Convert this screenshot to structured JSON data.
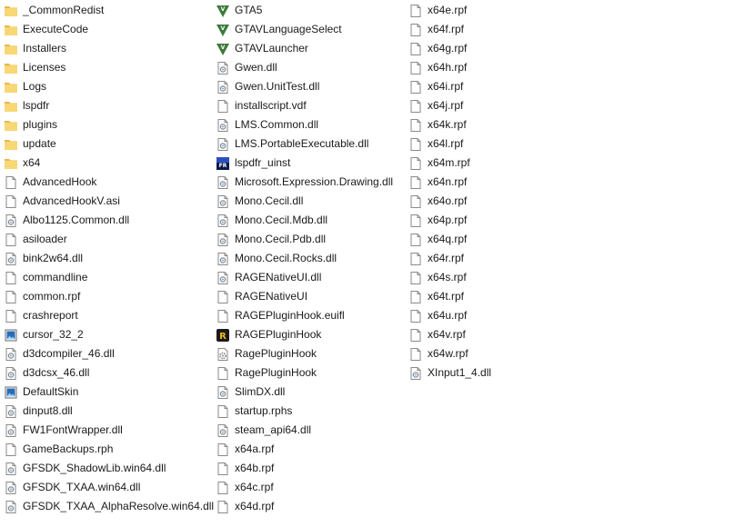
{
  "columns": [
    [
      {
        "label": "_CommonRedist",
        "icon": "folder"
      },
      {
        "label": "ExecuteCode",
        "icon": "folder"
      },
      {
        "label": "Installers",
        "icon": "folder"
      },
      {
        "label": "Licenses",
        "icon": "folder"
      },
      {
        "label": "Logs",
        "icon": "folder"
      },
      {
        "label": "lspdfr",
        "icon": "folder"
      },
      {
        "label": "plugins",
        "icon": "folder"
      },
      {
        "label": "update",
        "icon": "folder"
      },
      {
        "label": "x64",
        "icon": "folder"
      },
      {
        "label": "AdvancedHook",
        "icon": "file"
      },
      {
        "label": "AdvancedHookV.asi",
        "icon": "file"
      },
      {
        "label": "Albo1125.Common.dll",
        "icon": "dll"
      },
      {
        "label": "asiloader",
        "icon": "file"
      },
      {
        "label": "bink2w64.dll",
        "icon": "dll"
      },
      {
        "label": "commandline",
        "icon": "file"
      },
      {
        "label": "common.rpf",
        "icon": "file"
      },
      {
        "label": "crashreport",
        "icon": "file"
      },
      {
        "label": "cursor_32_2",
        "icon": "image"
      },
      {
        "label": "d3dcompiler_46.dll",
        "icon": "dll"
      },
      {
        "label": "d3dcsx_46.dll",
        "icon": "dll"
      },
      {
        "label": "DefaultSkin",
        "icon": "image"
      },
      {
        "label": "dinput8.dll",
        "icon": "dll"
      },
      {
        "label": "FW1FontWrapper.dll",
        "icon": "dll"
      },
      {
        "label": "GameBackups.rph",
        "icon": "file"
      },
      {
        "label": "GFSDK_ShadowLib.win64.dll",
        "icon": "dll"
      },
      {
        "label": "GFSDK_TXAA.win64.dll",
        "icon": "dll"
      },
      {
        "label": "GFSDK_TXAA_AlphaResolve.win64.dll",
        "icon": "dll"
      }
    ],
    [
      {
        "label": "GTA5",
        "icon": "gta"
      },
      {
        "label": "GTAVLanguageSelect",
        "icon": "gta"
      },
      {
        "label": "GTAVLauncher",
        "icon": "gta"
      },
      {
        "label": "Gwen.dll",
        "icon": "dll"
      },
      {
        "label": "Gwen.UnitTest.dll",
        "icon": "dll"
      },
      {
        "label": "installscript.vdf",
        "icon": "file"
      },
      {
        "label": "LMS.Common.dll",
        "icon": "dll"
      },
      {
        "label": "LMS.PortableExecutable.dll",
        "icon": "dll"
      },
      {
        "label": "lspdfr_uinst",
        "icon": "uninst"
      },
      {
        "label": "Microsoft.Expression.Drawing.dll",
        "icon": "dll"
      },
      {
        "label": "Mono.Cecil.dll",
        "icon": "dll"
      },
      {
        "label": "Mono.Cecil.Mdb.dll",
        "icon": "dll"
      },
      {
        "label": "Mono.Cecil.Pdb.dll",
        "icon": "dll"
      },
      {
        "label": "Mono.Cecil.Rocks.dll",
        "icon": "dll"
      },
      {
        "label": "RAGENativeUI.dll",
        "icon": "dll"
      },
      {
        "label": "RAGENativeUI",
        "icon": "file"
      },
      {
        "label": "RAGEPluginHook.euifl",
        "icon": "file"
      },
      {
        "label": "RAGEPluginHook",
        "icon": "rage"
      },
      {
        "label": "RagePluginHook",
        "icon": "config"
      },
      {
        "label": "RagePluginHook",
        "icon": "file"
      },
      {
        "label": "SlimDX.dll",
        "icon": "dll"
      },
      {
        "label": "startup.rphs",
        "icon": "file"
      },
      {
        "label": "steam_api64.dll",
        "icon": "dll"
      },
      {
        "label": "x64a.rpf",
        "icon": "file"
      },
      {
        "label": "x64b.rpf",
        "icon": "file"
      },
      {
        "label": "x64c.rpf",
        "icon": "file"
      },
      {
        "label": "x64d.rpf",
        "icon": "file"
      }
    ],
    [
      {
        "label": "x64e.rpf",
        "icon": "file"
      },
      {
        "label": "x64f.rpf",
        "icon": "file"
      },
      {
        "label": "x64g.rpf",
        "icon": "file"
      },
      {
        "label": "x64h.rpf",
        "icon": "file"
      },
      {
        "label": "x64i.rpf",
        "icon": "file"
      },
      {
        "label": "x64j.rpf",
        "icon": "file"
      },
      {
        "label": "x64k.rpf",
        "icon": "file"
      },
      {
        "label": "x64l.rpf",
        "icon": "file"
      },
      {
        "label": "x64m.rpf",
        "icon": "file"
      },
      {
        "label": "x64n.rpf",
        "icon": "file"
      },
      {
        "label": "x64o.rpf",
        "icon": "file"
      },
      {
        "label": "x64p.rpf",
        "icon": "file"
      },
      {
        "label": "x64q.rpf",
        "icon": "file"
      },
      {
        "label": "x64r.rpf",
        "icon": "file"
      },
      {
        "label": "x64s.rpf",
        "icon": "file"
      },
      {
        "label": "x64t.rpf",
        "icon": "file"
      },
      {
        "label": "x64u.rpf",
        "icon": "file"
      },
      {
        "label": "x64v.rpf",
        "icon": "file"
      },
      {
        "label": "x64w.rpf",
        "icon": "file"
      },
      {
        "label": "XInput1_4.dll",
        "icon": "dll"
      }
    ]
  ],
  "colors": {
    "folder": "#f8d775",
    "folder_dark": "#e8b84a",
    "file_border": "#8a8a8a",
    "gta_green": "#3d7a3a",
    "image_blue": "#2a6db5"
  }
}
